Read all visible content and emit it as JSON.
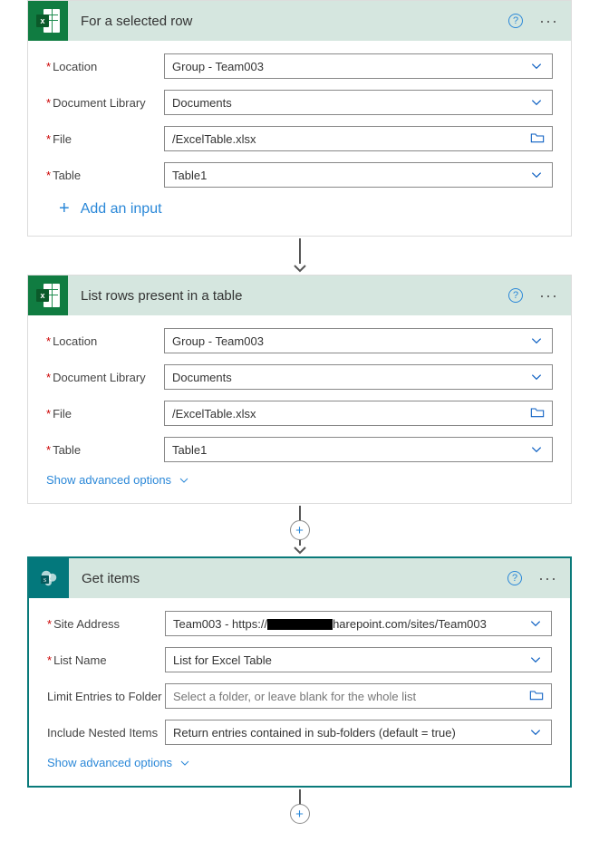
{
  "cards": {
    "selectedRow": {
      "title": "For a selected row",
      "fields": {
        "location": {
          "label": "Location",
          "required": true,
          "value": "Group - Team003",
          "kind": "dropdown"
        },
        "docLibrary": {
          "label": "Document Library",
          "required": true,
          "value": "Documents",
          "kind": "dropdown"
        },
        "file": {
          "label": "File",
          "required": true,
          "value": "/ExcelTable.xlsx",
          "kind": "file"
        },
        "table": {
          "label": "Table",
          "required": true,
          "value": "Table1",
          "kind": "dropdown"
        }
      },
      "addInputLabel": "Add an input"
    },
    "listRows": {
      "title": "List rows present in a table",
      "fields": {
        "location": {
          "label": "Location",
          "required": true,
          "value": "Group - Team003",
          "kind": "dropdown"
        },
        "docLibrary": {
          "label": "Document Library",
          "required": true,
          "value": "Documents",
          "kind": "dropdown"
        },
        "file": {
          "label": "File",
          "required": true,
          "value": "/ExcelTable.xlsx",
          "kind": "file"
        },
        "table": {
          "label": "Table",
          "required": true,
          "value": "Table1",
          "kind": "dropdown"
        }
      },
      "advancedLabel": "Show advanced options"
    },
    "getItems": {
      "title": "Get items",
      "fields": {
        "siteAddress": {
          "label": "Site Address",
          "required": true,
          "prefix": "Team003 - https://",
          "suffix": "harepoint.com/sites/Team003",
          "kind": "dropdown"
        },
        "listName": {
          "label": "List Name",
          "required": true,
          "value": "List for Excel Table",
          "kind": "dropdown"
        },
        "limitFolder": {
          "label": "Limit Entries to Folder",
          "required": false,
          "placeholder": "Select a folder, or leave blank for the whole list",
          "kind": "file"
        },
        "includeNested": {
          "label": "Include Nested Items",
          "required": false,
          "value": "Return entries contained in sub-folders (default = true)",
          "kind": "dropdown"
        }
      },
      "advancedLabel": "Show advanced options"
    }
  }
}
